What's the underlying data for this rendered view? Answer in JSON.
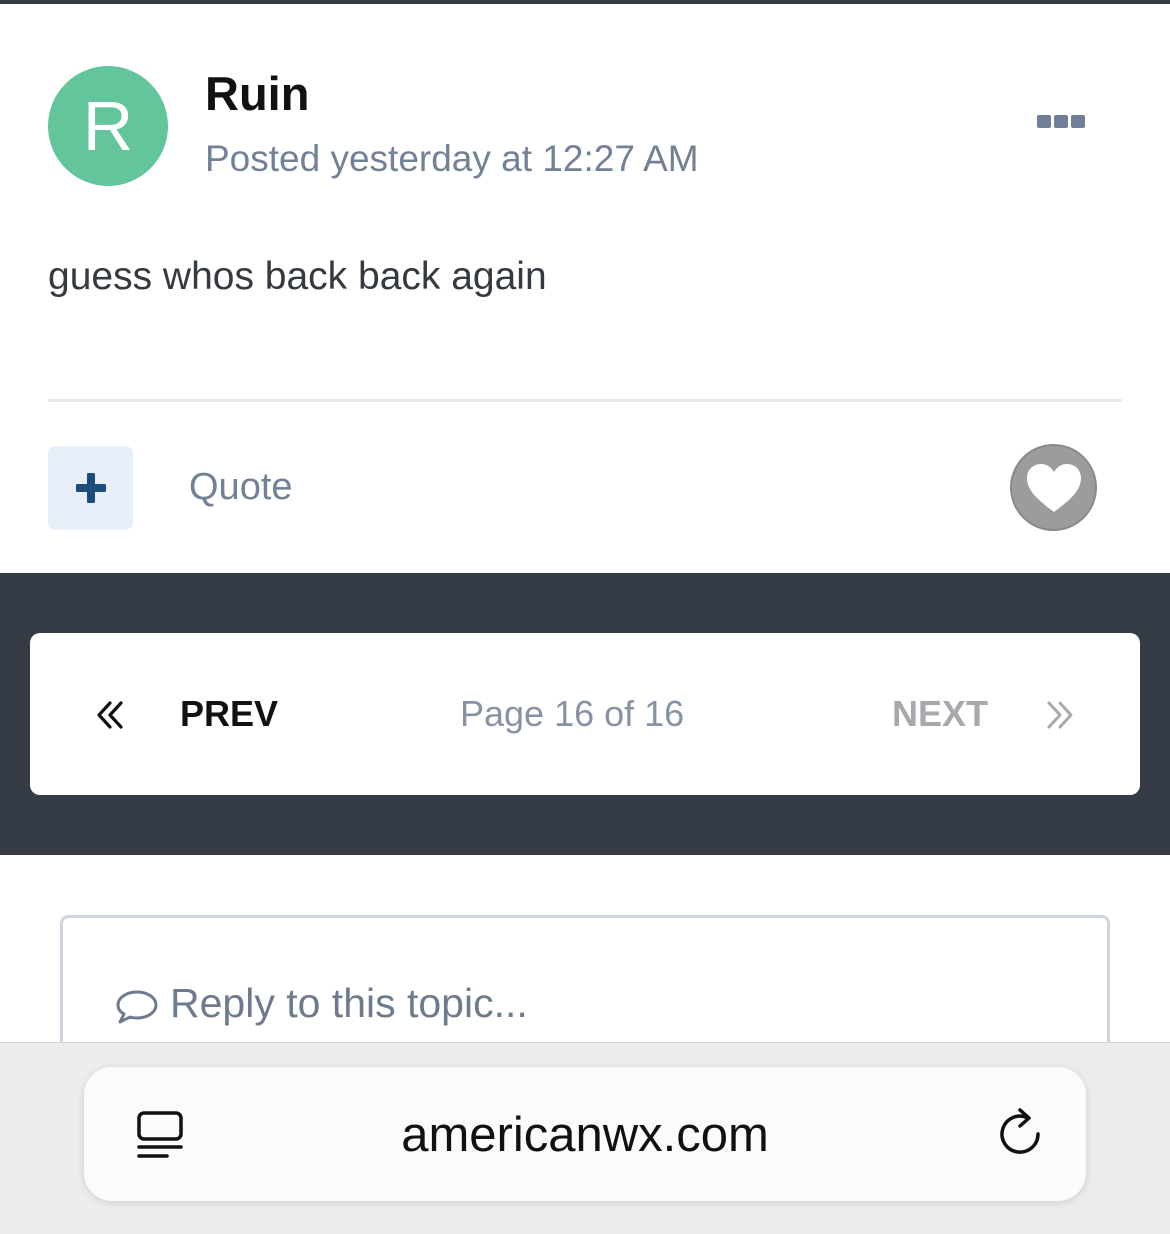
{
  "post": {
    "avatar_letter": "R",
    "author": "Ruin",
    "posted": "Posted yesterday at 12:27 AM",
    "body": "guess whos back back again",
    "quote_label": "Quote"
  },
  "pagination": {
    "prev_label": "PREV",
    "status": "Page 16 of 16",
    "next_label": "NEXT"
  },
  "reply": {
    "placeholder": "Reply to this topic..."
  },
  "browser": {
    "url": "americanwx.com"
  },
  "icons": {
    "more": "more-options-icon",
    "plus": "plus-icon",
    "like": "heart-icon",
    "prev": "double-chevron-left-icon",
    "next": "double-chevron-right-icon",
    "reply": "speech-bubble-icon",
    "reader": "reader-mode-icon",
    "reload": "reload-icon"
  },
  "colors": {
    "avatar": "#62c59b",
    "accent_blue": "#1d4e7b",
    "muted_text": "#738196",
    "dark_band": "#353c45"
  }
}
